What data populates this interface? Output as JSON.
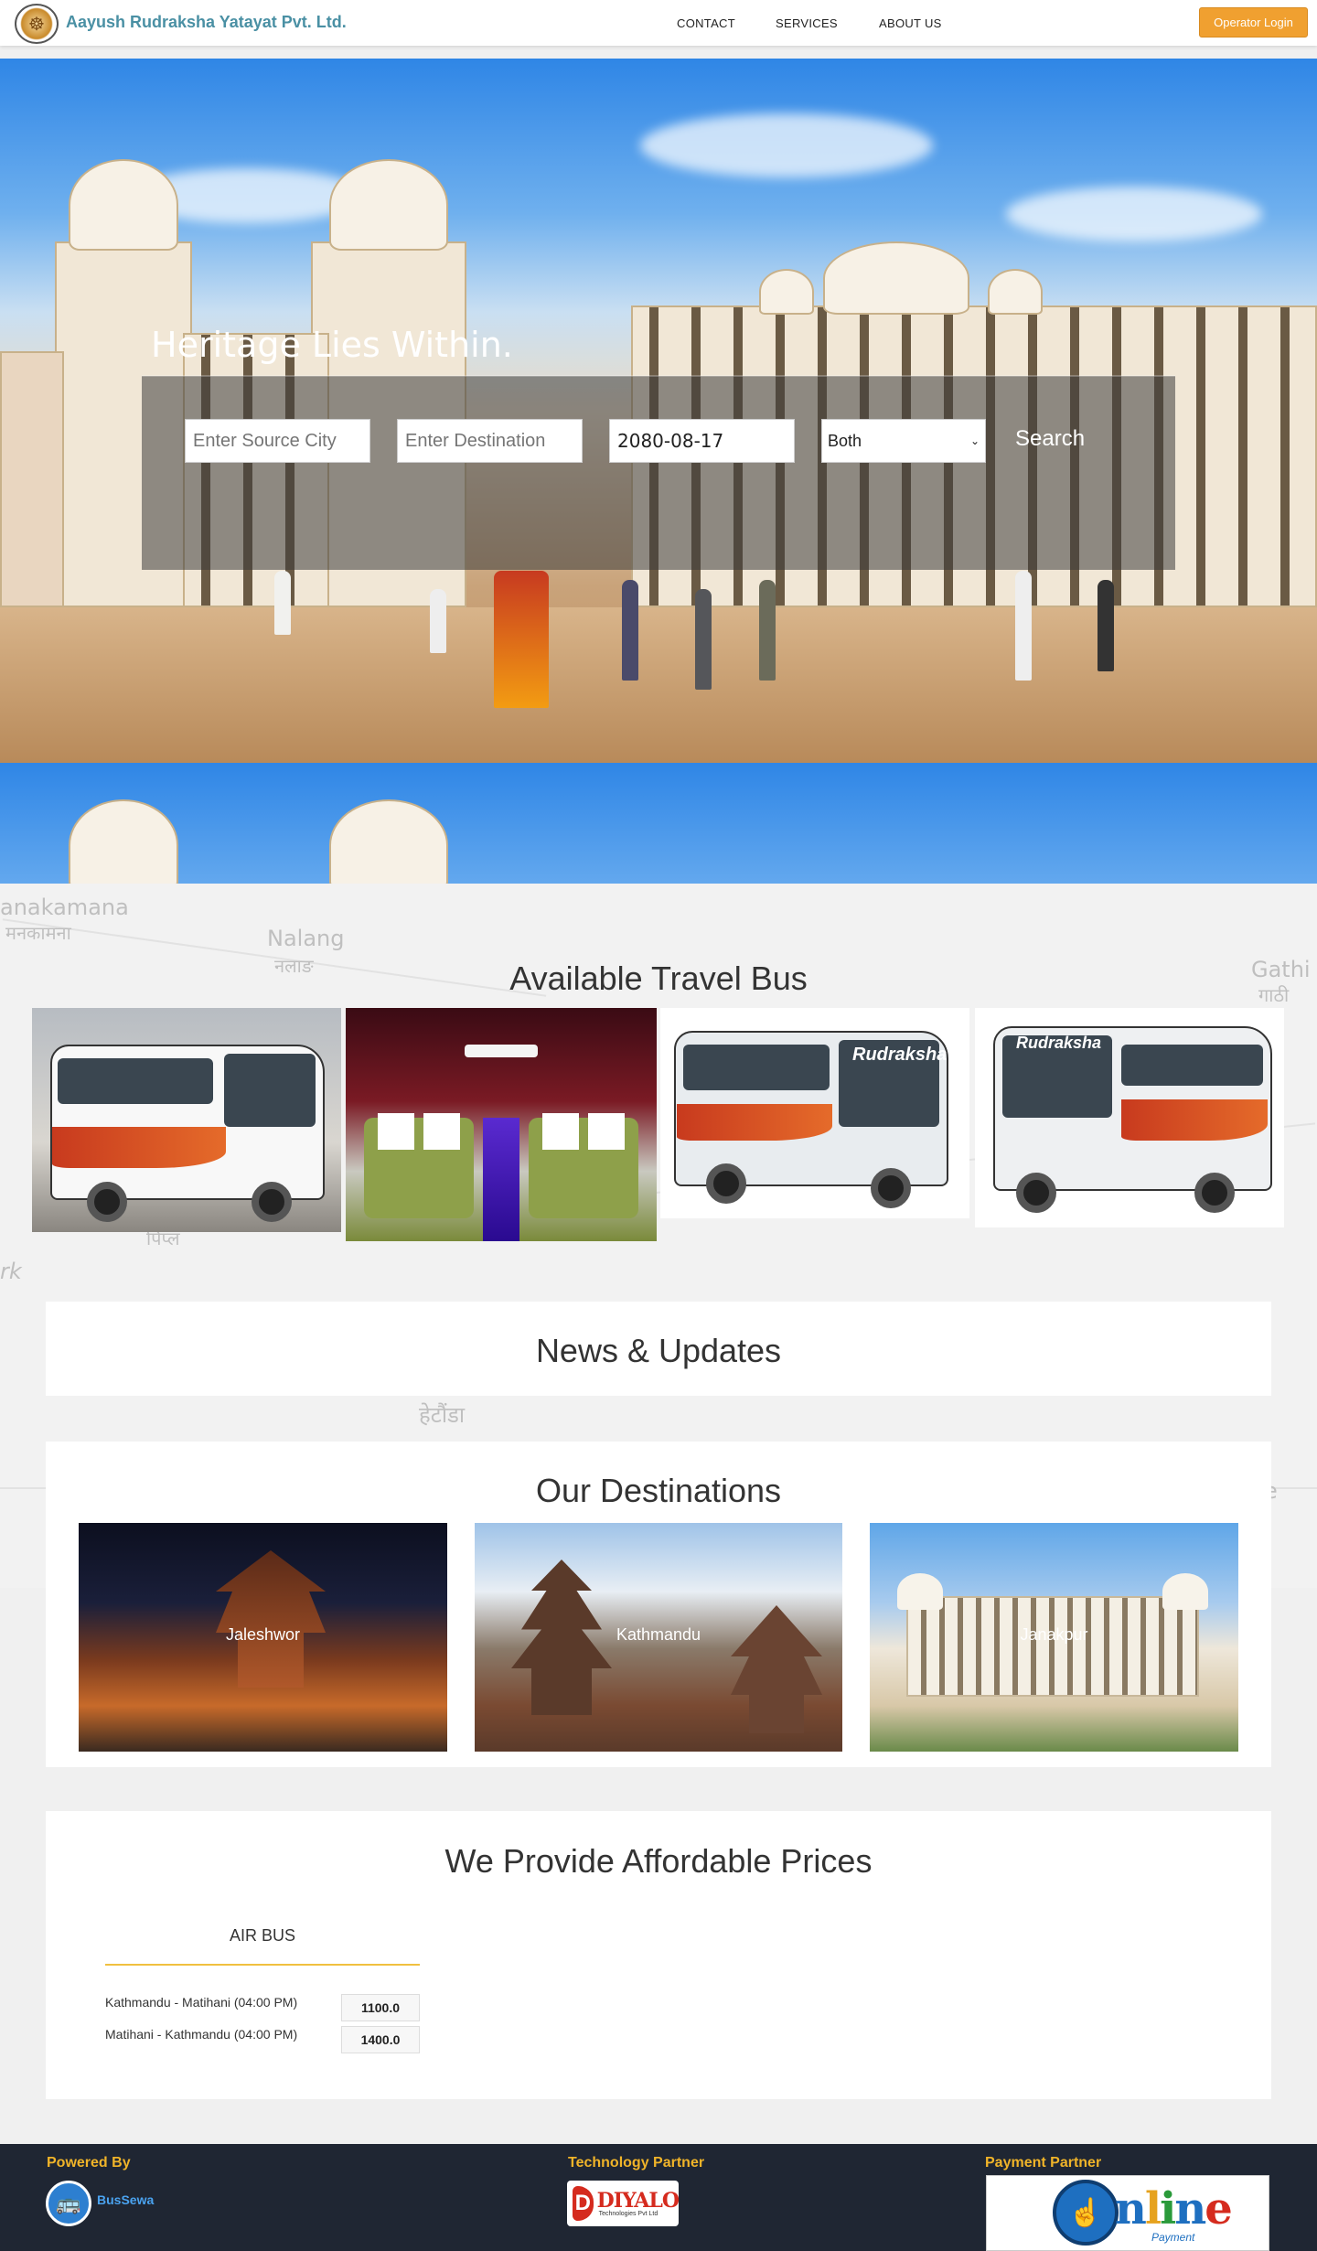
{
  "brand": {
    "name": "Aayush Rudraksha Yatayat Pvt. Ltd.",
    "logo_icon": "temple-seal-icon"
  },
  "nav": {
    "contact": "CONTACT",
    "services": "SERVICES",
    "about": "ABOUT US",
    "login": "Operator Login"
  },
  "hero": {
    "title": "Heritage Lies Within.",
    "source_placeholder": "Enter Source City",
    "destination_placeholder": "Enter Destination",
    "date_value": "2080-08-17",
    "trip_type_value": "Both",
    "search_label": "Search"
  },
  "map_labels": {
    "manakamana": "anakamana",
    "manakamana_np": "मनकामना",
    "nalang": "Nalang",
    "nalang_np": "नलाङ",
    "gathi": "Gathi",
    "gathi_np": "गाठी",
    "pipal_np": "पिप्ल",
    "hetauda_np": "हेटौंडा",
    "rk": "rk",
    "e": "e"
  },
  "buses": {
    "title": "Available Travel Bus",
    "brand_text": "Rudraksha"
  },
  "news": {
    "title": "News & Updates"
  },
  "destinations": {
    "title": "Our Destinations",
    "items": [
      {
        "name": "Jaleshwor"
      },
      {
        "name": "Kathmandu"
      },
      {
        "name": "Janakpur"
      }
    ]
  },
  "prices": {
    "title": "We Provide Affordable Prices",
    "tab": "AIR BUS",
    "routes": [
      {
        "route": "Kathmandu - Matihani (04:00 PM)",
        "fare": "1100.0"
      },
      {
        "route": "Matihani - Kathmandu (04:00 PM)",
        "fare": "1400.0"
      }
    ]
  },
  "footer": {
    "powered_by": "Powered By",
    "powered_name": "BusSewa",
    "tech_partner": "Technology Partner",
    "tech_logo_text": "DIYALO",
    "tech_logo_sub": "Technologies Pvt Ltd",
    "payment_partner": "Payment Partner",
    "payment_logo_text": "nline",
    "payment_logo_sub": "Payment"
  },
  "colors": {
    "brand_teal": "#4a90a4",
    "login_orange": "#f0a030",
    "accent_gold": "#f0b429",
    "footer_bg": "#1f2633"
  }
}
